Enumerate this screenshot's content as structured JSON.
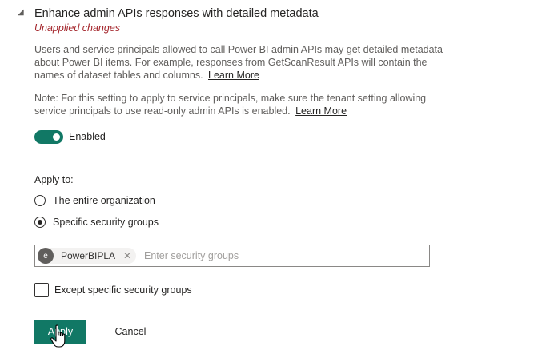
{
  "setting": {
    "title": "Enhance admin APIs responses with detailed metadata",
    "status": "Unapplied changes",
    "description": "Users and service principals allowed to call Power BI admin APIs may get detailed metadata about Power BI items. For example, responses from GetScanResult APIs will contain the names of dataset tables and columns.",
    "description_link": "Learn More",
    "note": "Note: For this setting to apply to service principals, make sure the tenant setting allowing service principals to use read-only admin APIs is enabled.",
    "note_link": "Learn More"
  },
  "toggle": {
    "state": "on",
    "label": "Enabled"
  },
  "apply_to": {
    "label": "Apply to:",
    "options": [
      {
        "label": "The entire organization",
        "selected": false
      },
      {
        "label": "Specific security groups",
        "selected": true
      }
    ]
  },
  "security_groups": {
    "chips": [
      {
        "initial": "e",
        "label": "PowerBIPLA"
      }
    ],
    "placeholder": "Enter security groups"
  },
  "except": {
    "label": "Except specific security groups",
    "checked": false
  },
  "buttons": {
    "apply": "Apply",
    "cancel": "Cancel"
  },
  "colors": {
    "accent": "#117865",
    "warning": "#a4262c"
  }
}
